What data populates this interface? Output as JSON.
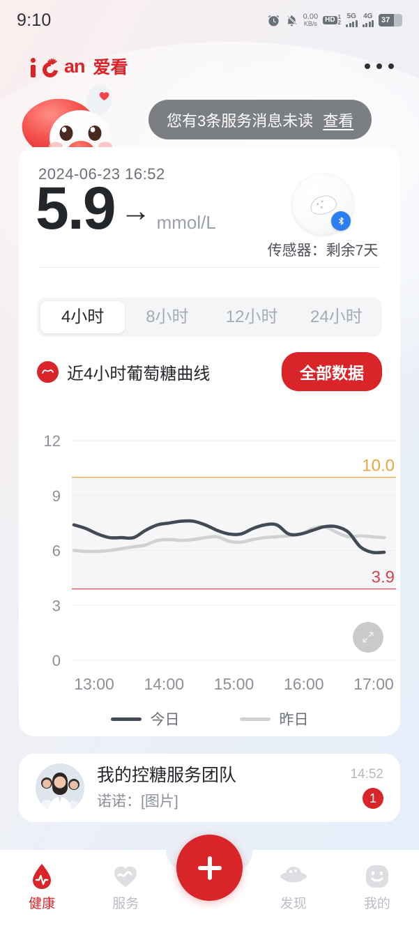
{
  "status_bar": {
    "time": "9:10",
    "net_speed_value": "0.00",
    "net_speed_unit": "KB/s",
    "hd_label": "HD",
    "hd_sup": "1",
    "hd_sub": "2",
    "sim1_label": "5G",
    "sim2_label": "4G",
    "battery_percent": "37"
  },
  "header": {
    "logo_text_an": "an",
    "logo_text_cn": "爱看",
    "more_icon": "more-dots-icon"
  },
  "message_bar": {
    "text": "您有3条服务消息未读",
    "link": "查看"
  },
  "glucose": {
    "timestamp": "2024-06-23 16:52",
    "value": "5.9",
    "trend_arrow": "→",
    "unit": "mmol/L",
    "sensor_label": "传感器：剩余7天"
  },
  "range_tabs": {
    "items": [
      {
        "label": "4小时",
        "active": true
      },
      {
        "label": "8小时",
        "active": false
      },
      {
        "label": "12小时",
        "active": false
      },
      {
        "label": "24小时",
        "active": false
      }
    ]
  },
  "chart_header": {
    "title": "近4小时葡萄糖曲线",
    "button_label": "全部数据"
  },
  "chart_data": {
    "type": "line",
    "title": "近4小时葡萄糖曲线",
    "xlabel": "",
    "ylabel": "mmol/L",
    "ylim": [
      0,
      12
    ],
    "yticks": [
      0,
      3,
      6,
      9,
      12
    ],
    "ytick_labels": [
      "0",
      "3",
      "6",
      "9",
      "12"
    ],
    "xticks": [
      "13:00",
      "14:00",
      "15:00",
      "16:00",
      "17:00"
    ],
    "xlim": [
      "12:45",
      "17:10"
    ],
    "grid": true,
    "legend_position": "bottom",
    "thresholds": [
      {
        "label": "10.0",
        "value": 10.0,
        "color": "#e8a83c"
      },
      {
        "label": "3.9",
        "value": 3.9,
        "color": "#d0464f"
      }
    ],
    "target_band": {
      "low": 3.9,
      "high": 10.0,
      "fill": "#f6f6f8"
    },
    "series": [
      {
        "name": "今日",
        "color": "#414a55",
        "x": [
          "12:47",
          "12:55",
          "13:05",
          "13:15",
          "13:25",
          "13:35",
          "13:45",
          "13:55",
          "14:05",
          "14:15",
          "14:25",
          "14:35",
          "14:45",
          "14:55",
          "15:05",
          "15:15",
          "15:25",
          "15:35",
          "15:45",
          "15:55",
          "16:05",
          "16:15",
          "16:25",
          "16:35",
          "16:45",
          "16:55",
          "17:05"
        ],
        "values": [
          7.4,
          7.2,
          6.9,
          6.7,
          6.7,
          6.7,
          7.1,
          7.4,
          7.5,
          7.6,
          7.6,
          7.4,
          7.1,
          6.9,
          6.9,
          7.2,
          7.4,
          7.4,
          6.9,
          6.9,
          7.1,
          7.3,
          7.3,
          7.0,
          6.2,
          5.9,
          5.9
        ]
      },
      {
        "name": "昨日",
        "color": "#cfd1d3",
        "x": [
          "12:47",
          "12:55",
          "13:05",
          "13:15",
          "13:25",
          "13:35",
          "13:45",
          "13:55",
          "14:05",
          "14:15",
          "14:25",
          "14:35",
          "14:45",
          "14:55",
          "15:05",
          "15:15",
          "15:25",
          "15:35",
          "15:45",
          "15:55",
          "16:05",
          "16:15",
          "16:25",
          "16:35",
          "16:45",
          "16:55",
          "17:05"
        ],
        "values": [
          6.0,
          5.95,
          5.95,
          6.0,
          6.1,
          6.2,
          6.3,
          6.55,
          6.6,
          6.55,
          6.6,
          6.7,
          6.75,
          6.5,
          6.45,
          6.6,
          6.7,
          6.75,
          6.8,
          6.9,
          7.2,
          7.3,
          7.0,
          6.75,
          6.8,
          6.75,
          6.7
        ]
      }
    ]
  },
  "chart_controls": {
    "expand_icon": "expand-icon"
  },
  "legend": [
    {
      "label": "今日",
      "color": "#414a55"
    },
    {
      "label": "昨日",
      "color": "#cfd1d3"
    }
  ],
  "team_card": {
    "title": "我的控糖服务团队",
    "subtitle": "诺诺：[图片]",
    "time": "14:52",
    "unread": "1"
  },
  "tab_bar": {
    "items": [
      {
        "label": "健康",
        "icon": "blood-drop-icon",
        "active": true
      },
      {
        "label": "服务",
        "icon": "heart-service-icon",
        "active": false
      },
      {
        "label": "发现",
        "icon": "discover-icon",
        "active": false
      },
      {
        "label": "我的",
        "icon": "profile-smiley-icon",
        "active": false
      }
    ],
    "fab_icon": "plus-icon"
  },
  "colors": {
    "brand_red": "#d9252a",
    "today_line": "#414a55",
    "yesterday_line": "#cfd1d3",
    "high_threshold": "#e8a83c",
    "low_threshold": "#d0464f"
  }
}
